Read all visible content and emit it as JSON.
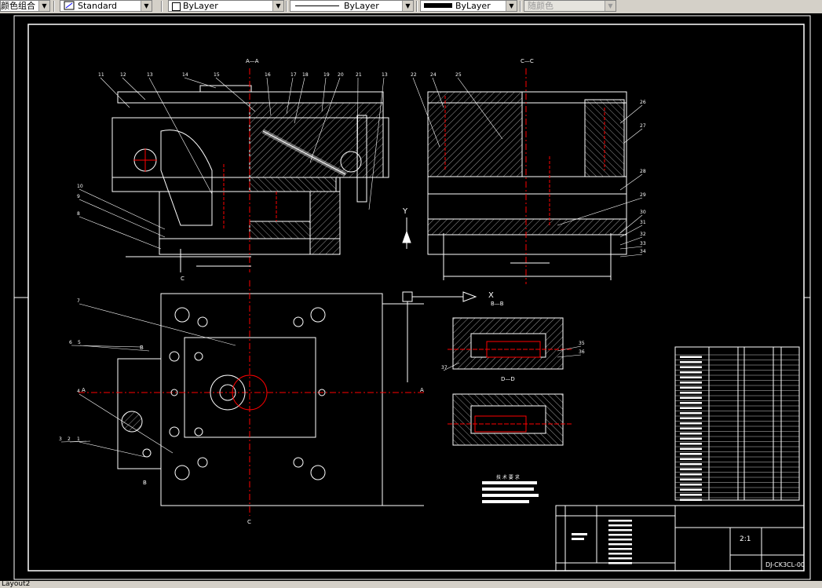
{
  "toolbar": {
    "fragment_label": "颜色组合",
    "textstyle_value": "Standard",
    "layer_value": "ByLayer",
    "linetype_value": "ByLayer",
    "lineweight_value": "ByLayer",
    "plotstyle_value": "随颜色"
  },
  "drawing": {
    "section_aa": "A—A",
    "section_cc": "C—C",
    "section_dd": "D—D",
    "view_bb": "B—B",
    "axis_y": "Y",
    "axis_x": "X",
    "label_a_left": "A",
    "label_a_right": "A",
    "label_c_top": "C",
    "label_c_bottom": "C",
    "label_b_top": "B",
    "label_b_bottom": "B",
    "tech_req_title": "技 术 要 求",
    "title_scale": "2:1",
    "drawing_number": "DJ-CK3CL-00",
    "part_callouts_left": [
      "11",
      "12",
      "13",
      "14",
      "15",
      "A—A",
      "16",
      "17",
      "18",
      "19",
      "20",
      "21",
      "13"
    ],
    "part_callouts_right": [
      "22",
      "24",
      "25",
      "26",
      "27",
      "28",
      "29",
      "30",
      "31",
      "32",
      "33",
      "34"
    ],
    "part_callouts_side": [
      "10",
      "9",
      "8",
      "7",
      "6",
      "5",
      "4",
      "3",
      "2",
      "1"
    ],
    "part_callouts_dd": [
      "35",
      "36",
      "37"
    ]
  },
  "status": {
    "layout_tab": "Layout2"
  }
}
